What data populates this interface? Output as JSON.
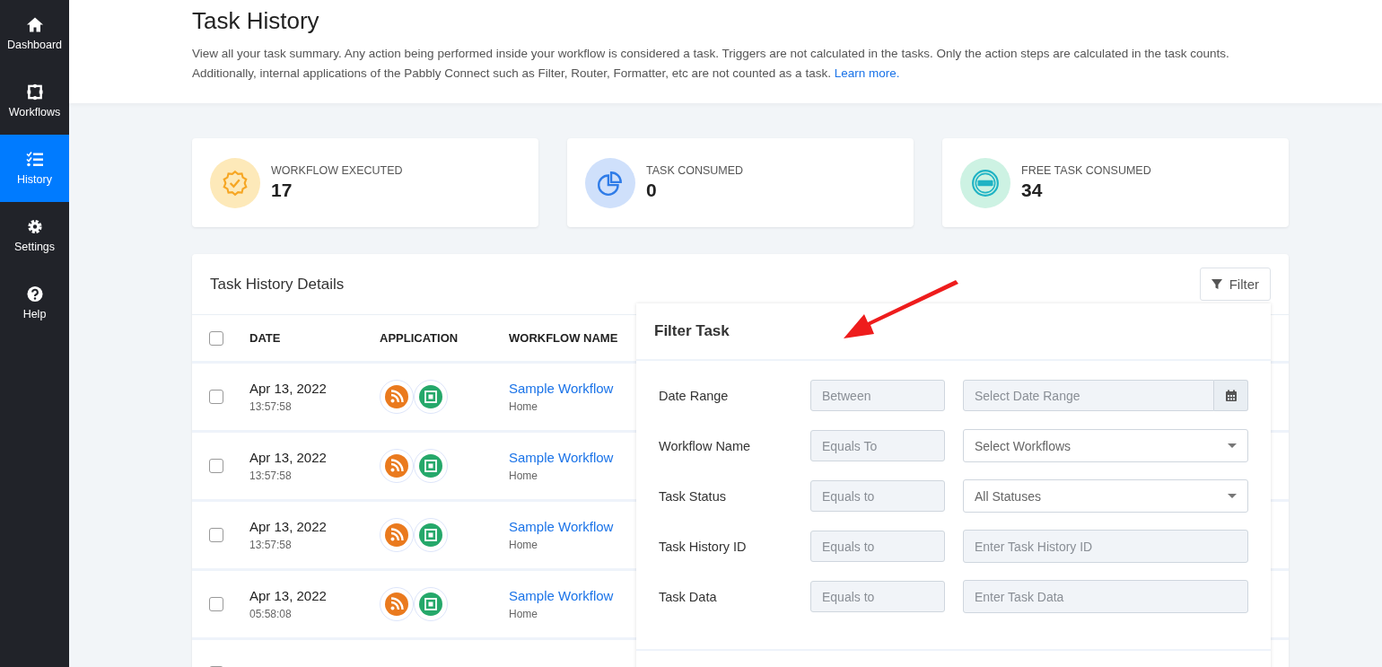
{
  "sidebar": {
    "items": [
      {
        "kind": "home",
        "label": "Dashboard",
        "selected": false
      },
      {
        "kind": "workflow",
        "label": "Workflows",
        "selected": false
      },
      {
        "kind": "list",
        "label": "History",
        "selected": true
      },
      {
        "kind": "gear",
        "label": "Settings",
        "selected": false
      },
      {
        "kind": "help",
        "label": "Help",
        "selected": false
      }
    ]
  },
  "header": {
    "title": "Task History",
    "description": "View all your task summary. Any action being performed inside your workflow is considered a task. Triggers are not calculated in the tasks. Only the action steps are calculated in the task counts. Additionally, internal applications of the Pabbly Connect such as Filter, Router, Formatter, etc are not counted as a task.",
    "link": "Learn more."
  },
  "stats": [
    {
      "kind": "badge",
      "label": "WORKFLOW EXECUTED",
      "value": "17"
    },
    {
      "kind": "pie",
      "label": "TASK CONSUMED",
      "value": "0"
    },
    {
      "kind": "free",
      "label": "FREE TASK CONSUMED",
      "value": "34"
    }
  ],
  "table": {
    "title": "Task History Details",
    "filter_button": "Filter",
    "select_all_checked": false,
    "columns": [
      "DATE",
      "APPLICATION",
      "WORKFLOW NAME"
    ],
    "rows": [
      {
        "checked": false,
        "date": "Apr 13, 2022",
        "time": "13:57:58",
        "workflow": "Sample Workflow",
        "folder": "Home"
      },
      {
        "checked": false,
        "date": "Apr 13, 2022",
        "time": "13:57:58",
        "workflow": "Sample Workflow",
        "folder": "Home"
      },
      {
        "checked": false,
        "date": "Apr 13, 2022",
        "time": "13:57:58",
        "workflow": "Sample Workflow",
        "folder": "Home"
      },
      {
        "checked": false,
        "date": "Apr 13, 2022",
        "time": "05:58:08",
        "workflow": "Sample Workflow",
        "folder": "Home"
      }
    ]
  },
  "filter_panel": {
    "title": "Filter Task",
    "fields": [
      {
        "label": "Date Range",
        "operator": "Between",
        "kind": "date",
        "placeholder": "Select Date Range"
      },
      {
        "label": "Workflow Name",
        "operator": "Equals To",
        "kind": "select",
        "value": "Select Workflows"
      },
      {
        "label": "Task Status",
        "operator": "Equals to",
        "kind": "select",
        "value": "All Statuses"
      },
      {
        "label": "Task History ID",
        "operator": "Equals to",
        "kind": "input",
        "placeholder": "Enter Task History ID"
      },
      {
        "label": "Task Data",
        "operator": "Equals to",
        "kind": "input",
        "placeholder": "Enter Task Data"
      }
    ]
  }
}
